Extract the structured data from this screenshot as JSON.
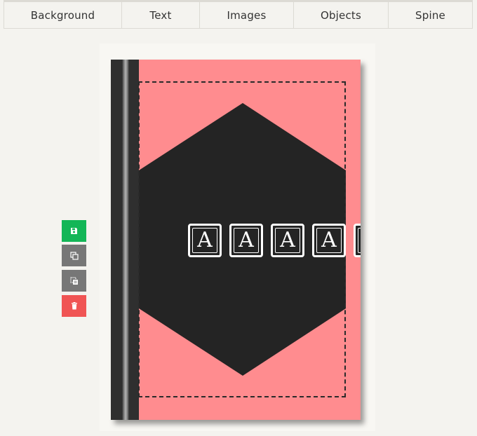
{
  "tabs": [
    "Background",
    "Text",
    "Images",
    "Objects",
    "Spine"
  ],
  "cover": {
    "glyph": "A",
    "colors": {
      "cover": "#ff8c8f",
      "shape": "#242424",
      "spine": "#2f2f2f"
    }
  },
  "tools": [
    {
      "icon": "save-icon",
      "color": "#13b657"
    },
    {
      "icon": "copy-icon",
      "color": "#777777"
    },
    {
      "icon": "duplicate-icon",
      "color": "#777777"
    },
    {
      "icon": "trash-icon",
      "color": "#f05454"
    }
  ]
}
